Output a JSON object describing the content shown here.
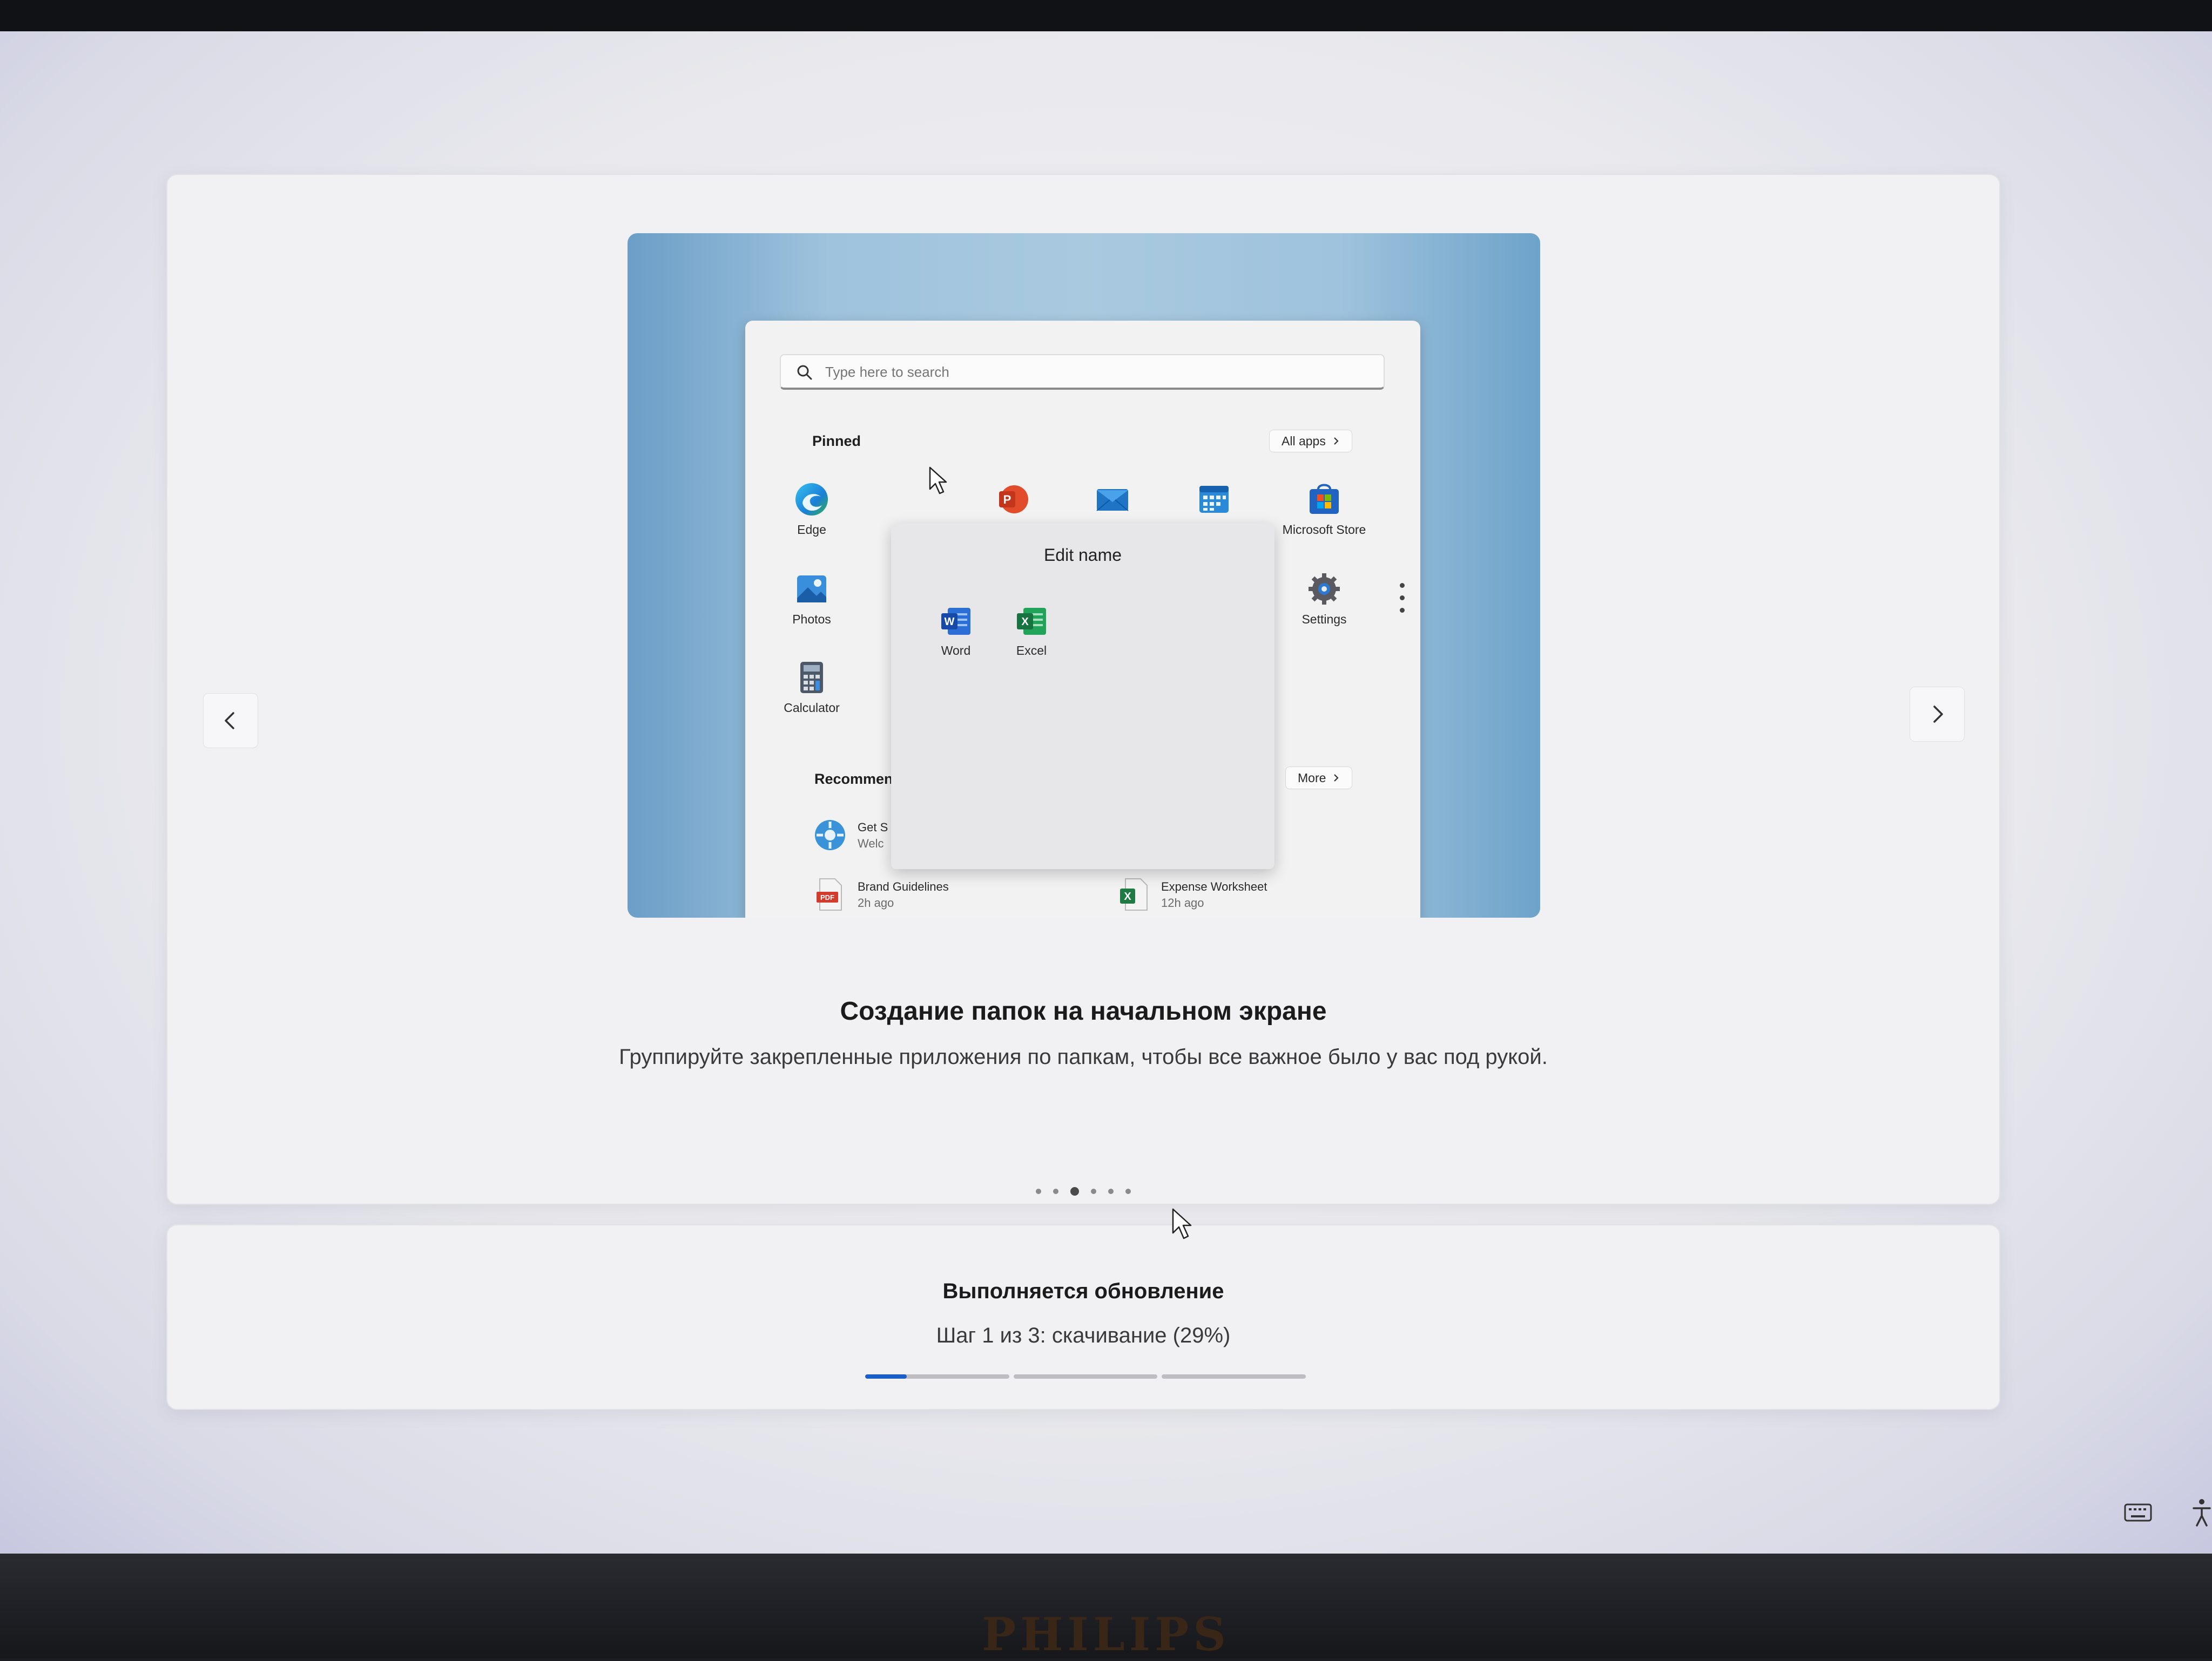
{
  "hero_preview": {
    "search_placeholder": "Type here to search",
    "pinned_label": "Pinned",
    "all_apps_label": "All apps",
    "apps": [
      {
        "name": "Edge",
        "icon": "edge-icon"
      },
      {
        "name": "Microsoft Store",
        "icon": "store-icon"
      },
      {
        "name": "Photos",
        "icon": "photos-icon"
      },
      {
        "name": "Settings",
        "icon": "settings-icon"
      },
      {
        "name": "Calculator",
        "icon": "calculator-icon"
      }
    ],
    "folder": {
      "title": "Edit name",
      "apps": [
        {
          "name": "Word",
          "icon": "word-icon"
        },
        {
          "name": "Excel",
          "icon": "excel-icon"
        }
      ]
    },
    "recommended_label": "Recommen",
    "more_label": "More",
    "recommended": [
      {
        "title": "Get S",
        "subtitle": "Welc"
      },
      {
        "title": "Brand Guidelines",
        "subtitle": "2h ago"
      },
      {
        "title": "Expense Worksheet",
        "subtitle": "12h ago"
      }
    ]
  },
  "slide": {
    "title": "Создание папок на начальном экране",
    "description": "Группируйте закрепленные приложения по папкам, чтобы все важное было у вас под рукой.",
    "page_count": 6,
    "active_page": 3
  },
  "status": {
    "title": "Выполняется обновление",
    "step_text": "Шаг 1 из 3: скачивание (29%)",
    "steps_total": 3,
    "current_step": 1,
    "current_step_progress": 0.29
  },
  "colors": {
    "progress_fill": "#1a5fc8",
    "progress_track": "#bdbdc2"
  },
  "monitor": {
    "brand": "PHILIPS"
  }
}
